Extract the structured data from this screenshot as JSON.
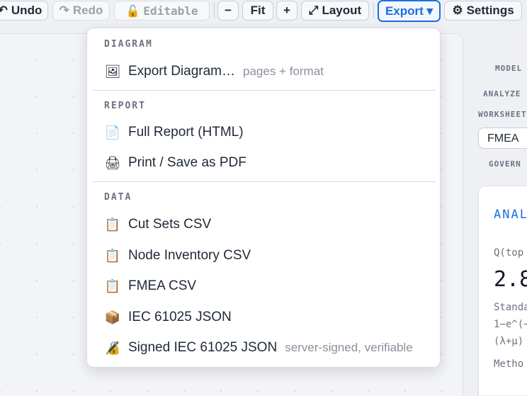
{
  "toolbar": {
    "undo": {
      "icon": "↶",
      "label": "Undo"
    },
    "redo": {
      "icon": "↷",
      "label": "Redo"
    },
    "editable": {
      "icon": "🔓",
      "label": "Editable"
    },
    "zoom_out": "−",
    "fit": "Fit",
    "zoom_in": "+",
    "layout": {
      "icon": "⤢",
      "label": "Layout"
    },
    "export": "Export ▾",
    "settings": {
      "icon": "⚙",
      "label": "Settings"
    }
  },
  "side_panel": {
    "model_label": "MODEL",
    "analyze_label": "ANALYZE",
    "worksheet_label": "WORKSHEET",
    "worksheet_value": "FMEA",
    "govern_label": "GOVERN",
    "card": {
      "title": "ANALYSIS",
      "q_label": "Q(top",
      "q_value": "2.8",
      "line1": "Standa",
      "line2": "1−e^(−",
      "line3": "(λ+μ)",
      "method": "Metho"
    }
  },
  "export_menu": {
    "sections": [
      {
        "title": "DIAGRAM",
        "items": [
          {
            "icon": "🖼",
            "label": "Export Diagram…",
            "hint": "pages + format"
          }
        ]
      },
      {
        "title": "REPORT",
        "items": [
          {
            "icon": "📄",
            "label": "Full Report (HTML)",
            "hint": ""
          },
          {
            "icon": "🖨",
            "label": "Print / Save as PDF",
            "hint": ""
          }
        ]
      },
      {
        "title": "DATA",
        "items": [
          {
            "icon": "📋",
            "label": "Cut Sets CSV",
            "hint": ""
          },
          {
            "icon": "📋",
            "label": "Node Inventory CSV",
            "hint": ""
          },
          {
            "icon": "📋",
            "label": "FMEA CSV",
            "hint": ""
          },
          {
            "icon": "📦",
            "label": "IEC 61025 JSON",
            "hint": ""
          },
          {
            "icon": "🔏",
            "label": "Signed IEC 61025 JSON",
            "hint": "server-signed, verifiable"
          }
        ]
      }
    ]
  },
  "colors": {
    "accent": "#1d6fe0",
    "background": "#eef0f4",
    "muted_text": "#8a919b"
  }
}
